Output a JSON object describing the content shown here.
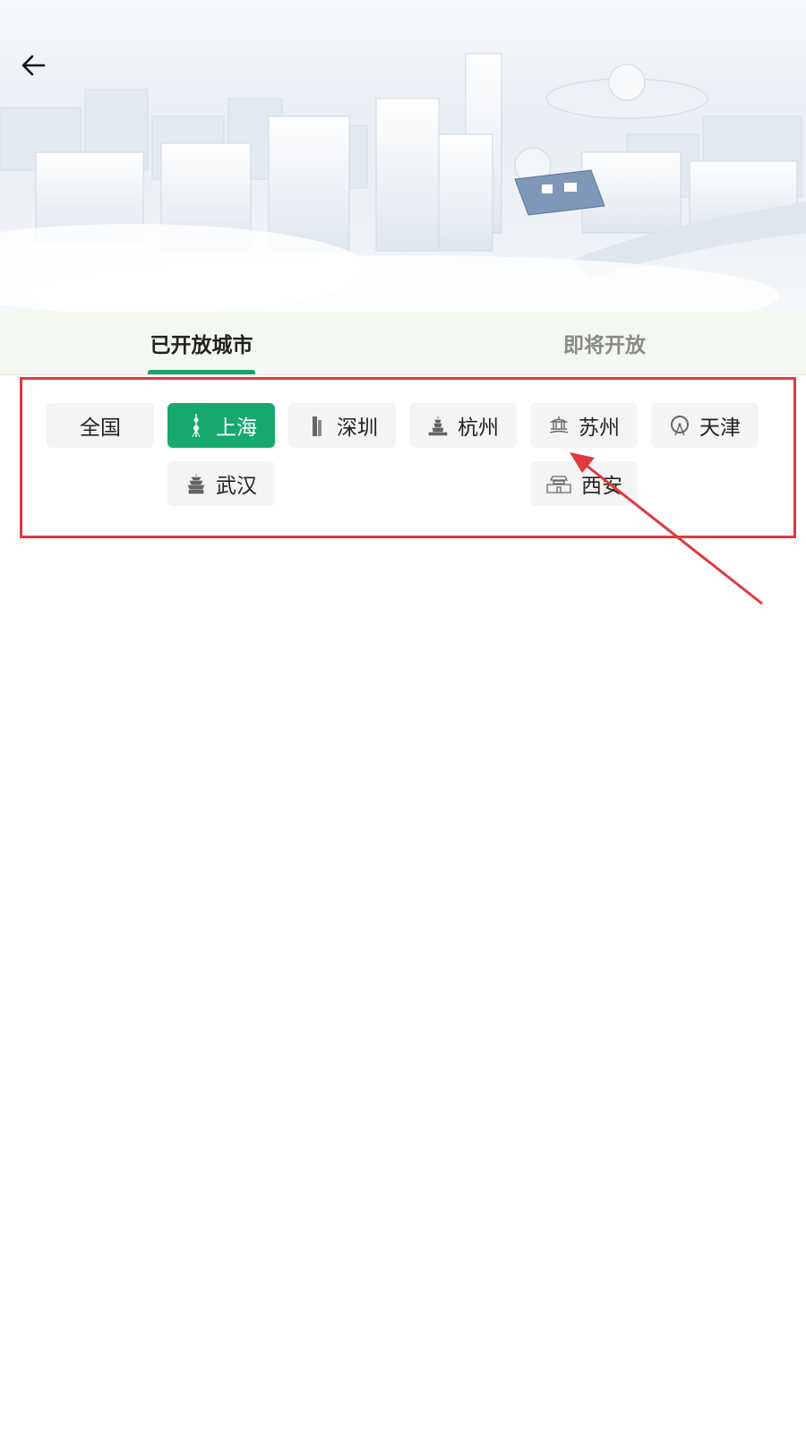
{
  "header": {
    "back_icon": "arrow-left-icon"
  },
  "tabs": [
    {
      "label": "已开放城市",
      "active": true
    },
    {
      "label": "即将开放",
      "active": false
    }
  ],
  "cities": [
    {
      "label": "全国",
      "icon": "",
      "selected": false
    },
    {
      "label": "上海",
      "icon": "oriental-pearl-tower-icon",
      "selected": true
    },
    {
      "label": "深圳",
      "icon": "skyscraper-icon",
      "selected": false
    },
    {
      "label": "杭州",
      "icon": "pagoda-icon",
      "selected": false
    },
    {
      "label": "苏州",
      "icon": "pavilion-icon",
      "selected": false
    },
    {
      "label": "天津",
      "icon": "ferris-wheel-icon",
      "selected": false
    },
    {
      "label": "武汉",
      "icon": "yellow-crane-tower-icon",
      "selected": false
    },
    {
      "label": "西安",
      "icon": "city-gate-icon",
      "selected": false
    }
  ],
  "colors": {
    "accent": "#17a86d",
    "tab_bg": "#f3f8f1",
    "annotation": "#e0393e"
  }
}
